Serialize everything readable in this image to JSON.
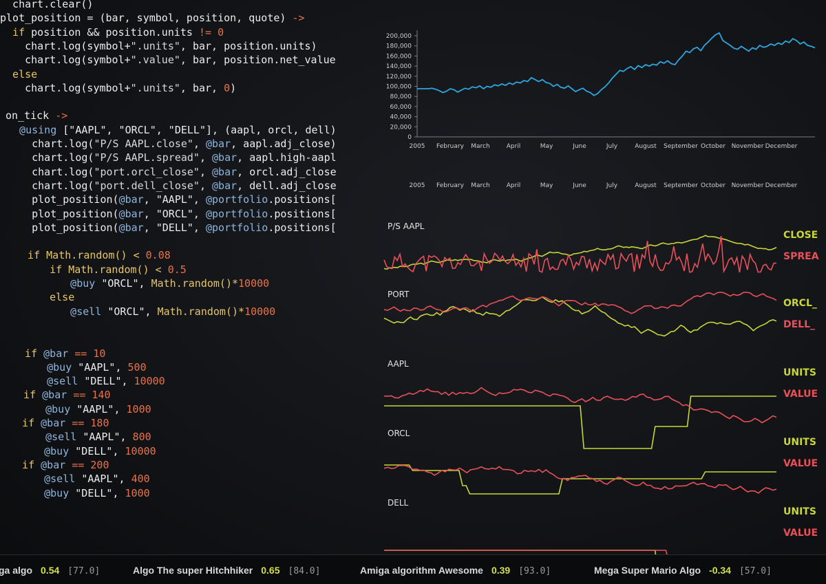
{
  "code_lines": [
    [
      {
        "t": "  chart.clear()",
        "c": "plain"
      }
    ],
    [
      {
        "t": "plot_position = (bar, symbol, position, quote) ",
        "c": "plain"
      },
      {
        "t": "->",
        "c": "op"
      }
    ],
    [
      {
        "t": "  if ",
        "c": "kw"
      },
      {
        "t": "position && position.units ",
        "c": "plain"
      },
      {
        "t": "!= 0",
        "c": "num"
      }
    ],
    [
      {
        "t": "    chart.log(symbol+",
        "c": "plain"
      },
      {
        "t": "\".units\"",
        "c": "str"
      },
      {
        "t": ", bar, position.units)",
        "c": "plain"
      }
    ],
    [
      {
        "t": "    chart.log(symbol+",
        "c": "plain"
      },
      {
        "t": "\".value\"",
        "c": "str"
      },
      {
        "t": ", bar, position.net_value",
        "c": "plain"
      }
    ],
    [
      {
        "t": "  else",
        "c": "kw"
      }
    ],
    [
      {
        "t": "    chart.log(symbol+",
        "c": "plain"
      },
      {
        "t": "\".units\"",
        "c": "str"
      },
      {
        "t": ", bar, ",
        "c": "plain"
      },
      {
        "t": "0",
        "c": "num"
      },
      {
        "t": ")",
        "c": "plain"
      }
    ],
    [],
    [
      {
        "t": "on_tick ",
        "c": "plain"
      },
      {
        "t": "->",
        "c": "op"
      }
    ],
    [
      {
        "t": "  @using ",
        "c": "at"
      },
      {
        "t": "[\"AAPL\", \"ORCL\", \"DELL\"], (aapl, orcl, dell)",
        "c": "plain"
      }
    ],
    [
      {
        "t": "    chart.log(",
        "c": "plain"
      },
      {
        "t": "\"P/S AAPL.close\"",
        "c": "str"
      },
      {
        "t": ", ",
        "c": "plain"
      },
      {
        "t": "@bar",
        "c": "at"
      },
      {
        "t": ", aapl.adj_close)",
        "c": "plain"
      }
    ],
    [
      {
        "t": "    chart.log(",
        "c": "plain"
      },
      {
        "t": "\"P/S AAPL.spread\"",
        "c": "str"
      },
      {
        "t": ", ",
        "c": "plain"
      },
      {
        "t": "@bar",
        "c": "at"
      },
      {
        "t": ", aapl.high-aapl.",
        "c": "plain"
      }
    ],
    [
      {
        "t": "    chart.log(",
        "c": "plain"
      },
      {
        "t": "\"port.orcl_close\"",
        "c": "str"
      },
      {
        "t": ", ",
        "c": "plain"
      },
      {
        "t": "@bar",
        "c": "at"
      },
      {
        "t": ", orcl.adj_close)",
        "c": "plain"
      }
    ],
    [
      {
        "t": "    chart.log(",
        "c": "plain"
      },
      {
        "t": "\"port.dell_close\"",
        "c": "str"
      },
      {
        "t": ", ",
        "c": "plain"
      },
      {
        "t": "@bar",
        "c": "at"
      },
      {
        "t": ", dell.adj_close)",
        "c": "plain"
      }
    ],
    [
      {
        "t": "    plot_position(",
        "c": "plain"
      },
      {
        "t": "@bar",
        "c": "at"
      },
      {
        "t": ", \"AAPL\", ",
        "c": "plain"
      },
      {
        "t": "@portfolio",
        "c": "at"
      },
      {
        "t": ".positions[\"",
        "c": "plain"
      }
    ],
    [
      {
        "t": "    plot_position(",
        "c": "plain"
      },
      {
        "t": "@bar",
        "c": "at"
      },
      {
        "t": ", \"ORCL\", ",
        "c": "plain"
      },
      {
        "t": "@portfolio",
        "c": "at"
      },
      {
        "t": ".positions[\"",
        "c": "plain"
      }
    ],
    [
      {
        "t": "    plot_position(",
        "c": "plain"
      },
      {
        "t": "@bar",
        "c": "at"
      },
      {
        "t": ", \"DELL\", ",
        "c": "plain"
      },
      {
        "t": "@portfolio",
        "c": "at"
      },
      {
        "t": ".positions[\"",
        "c": "plain"
      }
    ],
    [],
    [
      {
        "t": "  if ",
        "c": "kw"
      },
      {
        "t": "Math.random() < ",
        "c": "kw"
      },
      {
        "t": "0.08",
        "c": "num"
      }
    ],
    [
      {
        "t": "    if ",
        "c": "kw"
      },
      {
        "t": "Math.random() < ",
        "c": "kw"
      },
      {
        "t": "0.5",
        "c": "num"
      }
    ],
    [
      {
        "t": "      @buy ",
        "c": "at"
      },
      {
        "t": "\"ORCL\", ",
        "c": "plain"
      },
      {
        "t": "Math.random()*",
        "c": "kw"
      },
      {
        "t": "10000",
        "c": "num"
      }
    ],
    [
      {
        "t": "    else",
        "c": "kw"
      }
    ],
    [
      {
        "t": "      @sell ",
        "c": "at"
      },
      {
        "t": "\"ORCL\", ",
        "c": "plain"
      },
      {
        "t": "Math.random()*",
        "c": "kw"
      },
      {
        "t": "10000",
        "c": "num"
      }
    ],
    [],
    [],
    [
      {
        "t": "  if ",
        "c": "kw"
      },
      {
        "t": "@bar ",
        "c": "at"
      },
      {
        "t": "== 10",
        "c": "num"
      }
    ],
    [
      {
        "t": "    @buy ",
        "c": "at"
      },
      {
        "t": "\"AAPL\", ",
        "c": "plain"
      },
      {
        "t": "500",
        "c": "num"
      }
    ],
    [
      {
        "t": "    @sell ",
        "c": "at"
      },
      {
        "t": "\"DELL\", ",
        "c": "plain"
      },
      {
        "t": "10000",
        "c": "num"
      }
    ],
    [
      {
        "t": "  if ",
        "c": "kw"
      },
      {
        "t": "@bar ",
        "c": "at"
      },
      {
        "t": "== 140",
        "c": "num"
      }
    ],
    [
      {
        "t": "    @buy ",
        "c": "at"
      },
      {
        "t": "\"AAPL\", ",
        "c": "plain"
      },
      {
        "t": "1000",
        "c": "num"
      }
    ],
    [
      {
        "t": "  if ",
        "c": "kw"
      },
      {
        "t": "@bar ",
        "c": "at"
      },
      {
        "t": "== 180",
        "c": "num"
      }
    ],
    [
      {
        "t": "    @sell ",
        "c": "at"
      },
      {
        "t": "\"AAPL\", ",
        "c": "plain"
      },
      {
        "t": "800",
        "c": "num"
      }
    ],
    [
      {
        "t": "    @buy ",
        "c": "at"
      },
      {
        "t": "\"DELL\", ",
        "c": "plain"
      },
      {
        "t": "10000",
        "c": "num"
      }
    ],
    [
      {
        "t": "  if ",
        "c": "kw"
      },
      {
        "t": "@bar ",
        "c": "at"
      },
      {
        "t": "== 200",
        "c": "num"
      }
    ],
    [
      {
        "t": "    @sell ",
        "c": "at"
      },
      {
        "t": "\"AAPL\", ",
        "c": "plain"
      },
      {
        "t": "400",
        "c": "num"
      }
    ],
    [
      {
        "t": "    @buy ",
        "c": "at"
      },
      {
        "t": "\"DELL\", ",
        "c": "plain"
      },
      {
        "t": "1000",
        "c": "num"
      }
    ]
  ],
  "months": [
    "2005",
    "February",
    "March",
    "April",
    "May",
    "June",
    "July",
    "August",
    "September",
    "October",
    "November",
    "December"
  ],
  "main_chart": {
    "y_ticks": [
      "200,000",
      "180,000",
      "160,000",
      "140,000",
      "120,000",
      "100,000",
      "80,000",
      "60,000",
      "40,000",
      "20,000",
      "0"
    ],
    "ylim": [
      0,
      210000
    ],
    "color": "#2fa6e0",
    "series": [
      100000,
      100000,
      100000,
      100000,
      101000,
      99000,
      96000,
      92000,
      95000,
      100000,
      98000,
      93000,
      97000,
      101000,
      99000,
      104000,
      102000,
      106000,
      100000,
      105000,
      103000,
      108000,
      106000,
      110000,
      107000,
      112000,
      109000,
      114000,
      112000,
      117000,
      115000,
      123000,
      119000,
      115000,
      119000,
      113000,
      111000,
      105000,
      109000,
      103000,
      101000,
      106000,
      100000,
      94000,
      98000,
      101000,
      95000,
      92000,
      86000,
      90000,
      98000,
      104000,
      112000,
      122000,
      130000,
      138000,
      136000,
      142000,
      146000,
      140000,
      148000,
      144000,
      150000,
      147000,
      151000,
      149000,
      156000,
      153000,
      158000,
      152000,
      150000,
      160000,
      168000,
      178000,
      175000,
      183000,
      186000,
      179000,
      190000,
      197000,
      205000,
      212000,
      216000,
      200000,
      195000,
      190000,
      184000,
      182000,
      188000,
      183000,
      178000,
      185000,
      182000,
      190000,
      186000,
      188000,
      193000,
      190000,
      195000,
      192000,
      199000,
      196000,
      204000,
      200000,
      193000,
      197000,
      190000,
      188000,
      185000
    ]
  },
  "panels": [
    {
      "label": "P/S AAPL",
      "legend_top": "CLOSE",
      "legend_bottom": "SPREA"
    },
    {
      "label": "PORT",
      "legend_top": "ORCL_",
      "legend_bottom": "DELL_"
    },
    {
      "label": "AAPL",
      "legend_top": "UNITS",
      "legend_bottom": "VALUE"
    },
    {
      "label": "ORCL",
      "legend_top": "UNITS",
      "legend_bottom": "VALUE"
    },
    {
      "label": "DELL",
      "legend_top": "UNITS",
      "legend_bottom": "VALUE"
    }
  ],
  "colors": {
    "yellow": "#c8d637",
    "red": "#e8505a",
    "axis": "#7a7d85",
    "text": "#cfcfcf"
  },
  "algos": [
    {
      "name": "ga algo",
      "score": "0.54",
      "pct": "[77.0]"
    },
    {
      "name": "Algo The super Hitchhiker",
      "score": "0.65",
      "pct": "[84.0]"
    },
    {
      "name": "Amiga algorithm Awesome",
      "score": "0.39",
      "pct": "[93.0]"
    },
    {
      "name": "Mega Super Mario Algo",
      "score": "-0.34",
      "pct": "[57.0]"
    }
  ]
}
